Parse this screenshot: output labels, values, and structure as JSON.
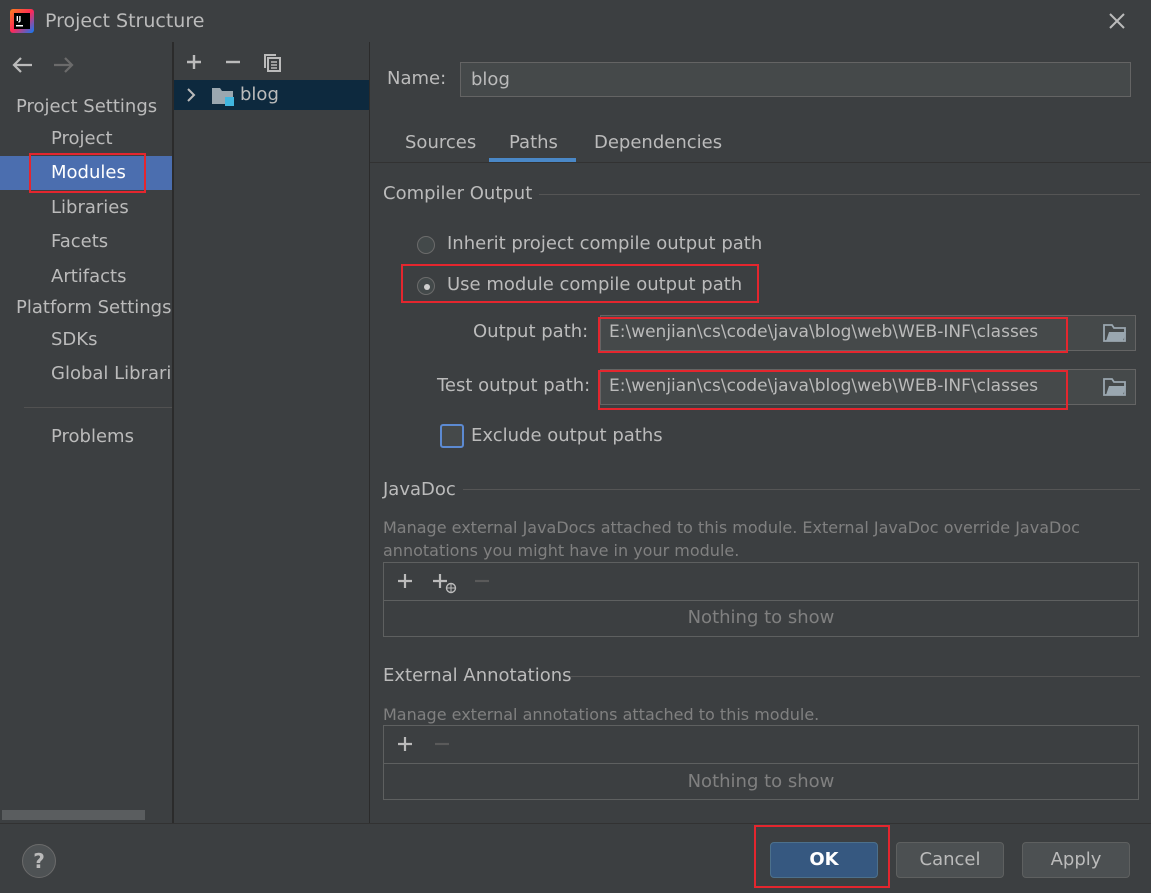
{
  "window": {
    "title": "Project Structure"
  },
  "nav": {
    "project_settings_header": "Project Settings",
    "platform_settings_header": "Platform Settings",
    "items": {
      "project": "Project",
      "modules": "Modules",
      "libraries": "Libraries",
      "facets": "Facets",
      "artifacts": "Artifacts",
      "sdks": "SDKs",
      "global_libraries": "Global Libraries",
      "problems": "Problems"
    },
    "selected": "Modules"
  },
  "tree": {
    "module_name": "blog"
  },
  "module": {
    "name_label": "Name:",
    "name_value": "blog",
    "tabs": [
      "Sources",
      "Paths",
      "Dependencies"
    ],
    "active_tab": "Paths"
  },
  "compiler_output": {
    "title": "Compiler Output",
    "inherit_label": "Inherit project compile output path",
    "use_module_label": "Use module compile output path",
    "selected_option": "Use module compile output path",
    "output_path_label": "Output path:",
    "output_path_value": "E:\\wenjian\\cs\\code\\java\\blog\\web\\WEB-INF\\classes",
    "test_output_path_label": "Test output path:",
    "test_output_path_value": "E:\\wenjian\\cs\\code\\java\\blog\\web\\WEB-INF\\classes",
    "exclude_label": "Exclude output paths",
    "exclude_checked": false
  },
  "javadoc": {
    "title": "JavaDoc",
    "description_line1": "Manage external JavaDocs attached to this module. External JavaDoc override JavaDoc",
    "description_line2": "annotations you might have in your module.",
    "empty_text": "Nothing to show"
  },
  "external_annotations": {
    "title": "External Annotations",
    "description": "Manage external annotations attached to this module.",
    "empty_text": "Nothing to show"
  },
  "buttons": {
    "help": "?",
    "ok": "OK",
    "cancel": "Cancel",
    "apply": "Apply"
  },
  "colors": {
    "background": "#3c3f41",
    "selection": "#4b6eaf",
    "tree_selection": "#0d293e",
    "highlight_box": "#e4262e",
    "ok_button": "#365880",
    "tab_underline": "#4a88c7"
  }
}
